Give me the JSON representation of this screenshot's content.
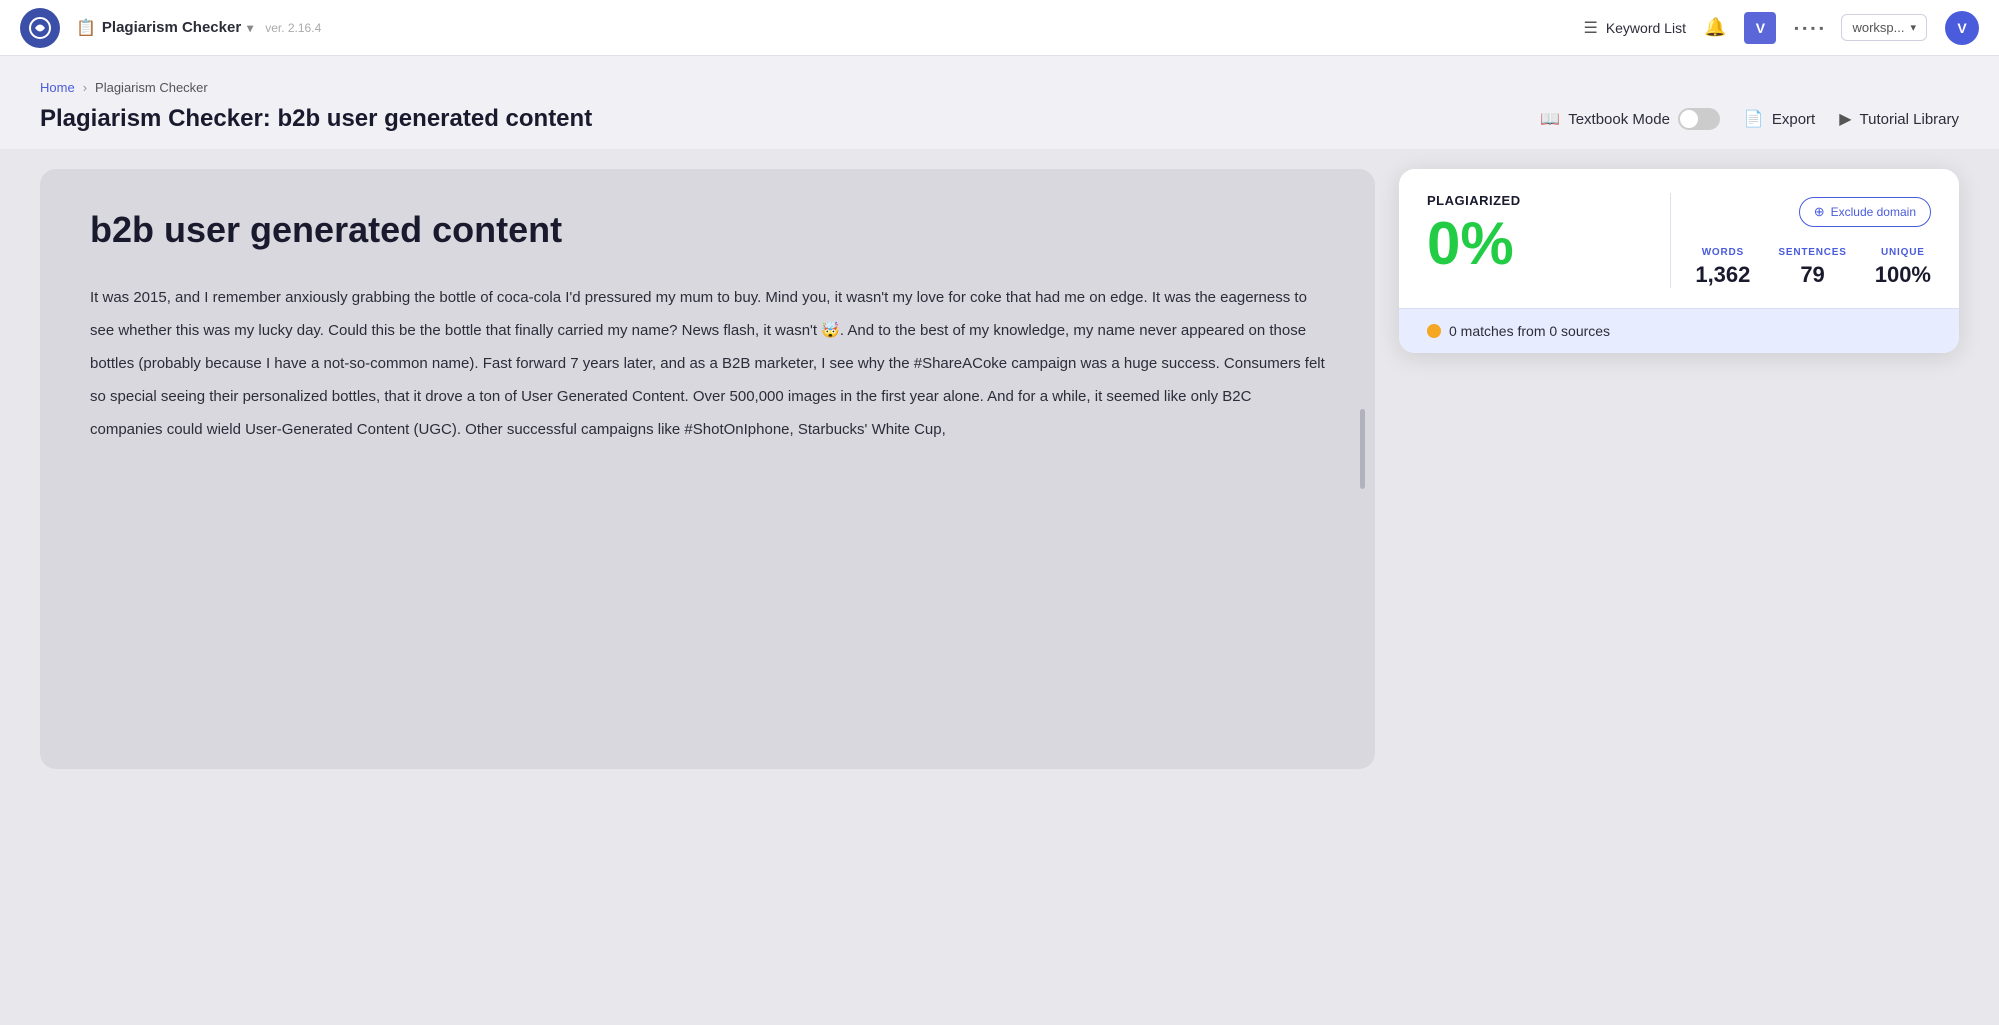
{
  "app": {
    "logo_letter": "⊕",
    "name": "Plagiarism Checker",
    "version": "ver. 2.16.4"
  },
  "topnav": {
    "keyword_list_label": "Keyword List",
    "workspace_label": "worksp...",
    "avatar_letter": "V",
    "v_letter": "V"
  },
  "breadcrumb": {
    "home": "Home",
    "separator": "›",
    "current": "Plagiarism Checker"
  },
  "page": {
    "title_bold": "Plagiarism Checker:",
    "title_rest": " b2b user generated content",
    "textbook_mode_label": "Textbook Mode",
    "export_label": "Export",
    "tutorial_library_label": "Tutorial Library"
  },
  "document": {
    "title": "b2b user generated content",
    "body": "It was 2015, and I remember anxiously grabbing the bottle of coca-cola I'd pressured my mum to buy. Mind you, it wasn't my love for coke that had me on edge. It was the eagerness to see whether this was my lucky day. Could this be the bottle that finally carried my name? News flash, it wasn't 🤯. And to the best of my knowledge, my name never appeared on those bottles (probably because I have a not-so-common name). Fast forward 7 years later, and as a B2B marketer, I see why the #ShareACoke campaign was a huge success. Consumers felt so special seeing their personalized bottles, that it drove a ton of User Generated Content. Over 500,000 images in the first year alone. And for a while, it seemed like only B2C companies could wield User-Generated Content (UGC). Other successful campaigns like #ShotOnIphone, Starbucks' White Cup,"
  },
  "results": {
    "plagiarized_label": "PLAGIARIZED",
    "plagiarized_pct": "0%",
    "exclude_domain_label": "Exclude domain",
    "words_label": "WORDS",
    "words_value": "1,362",
    "sentences_label": "SENTENCES",
    "sentences_value": "79",
    "unique_label": "UNIQUE",
    "unique_value": "100%",
    "matches_text": "0 matches from 0 sources"
  }
}
